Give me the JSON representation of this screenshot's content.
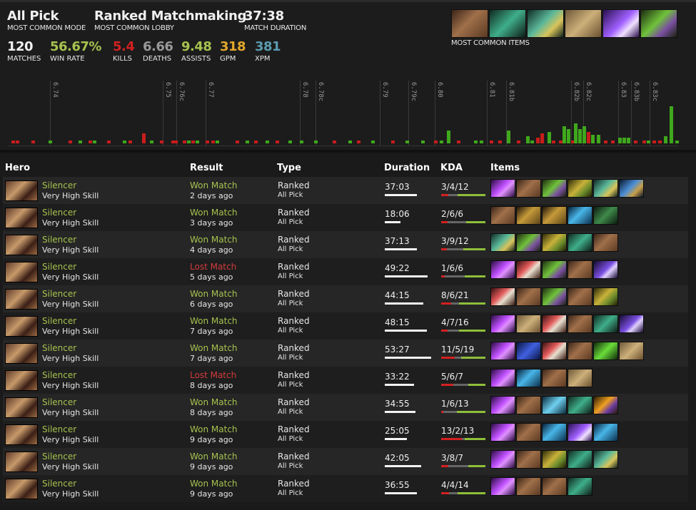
{
  "summary": {
    "mode": {
      "value": "All Pick",
      "caption": "MOST COMMON MODE"
    },
    "lobby": {
      "value": "Ranked Matchmaking",
      "caption": "MOST COMMON LOBBY"
    },
    "duration": {
      "value": "37:38",
      "caption": "MATCH DURATION"
    },
    "matches": {
      "value": "120",
      "caption": "MATCHES",
      "color": "#f0f0f0"
    },
    "winrate": {
      "value": "56.67%",
      "caption": "WIN RATE",
      "color": "#a6c24e"
    },
    "kills": {
      "value": "5.4",
      "caption": "KILLS",
      "color": "#d42020"
    },
    "deaths": {
      "value": "6.66",
      "caption": "DEATHS",
      "color": "#999999"
    },
    "assists": {
      "value": "9.48",
      "caption": "ASSISTS",
      "color": "#a6c24e"
    },
    "gpm": {
      "value": "318",
      "caption": "GPM",
      "color": "#e3a82b"
    },
    "xpm": {
      "value": "381",
      "caption": "XPM",
      "color": "#5b9bb0"
    },
    "items_caption": "MOST COMMON ITEMS",
    "common_items": [
      "boots-icon",
      "shadow-blade-icon",
      "magic-wand-icon",
      "scroll-icon",
      "silver-edge-icon",
      "bottle-icon"
    ]
  },
  "patches": [
    "6.74",
    "6.75",
    "6.76c",
    "6.77",
    "6.78",
    "6.78c",
    "6.79",
    "6.79c",
    "6.80",
    "6.81",
    "6.81b",
    "6.82b",
    "6.82c",
    "6.83",
    "6.83b",
    "6.83c"
  ],
  "colors": {
    "win": "#a6c24e",
    "loss": "#d43a3a",
    "bar_win": "#3fa81c",
    "bar_loss": "#c91c1c"
  },
  "headers": {
    "hero": "Hero",
    "result": "Result",
    "type": "Type",
    "duration": "Duration",
    "kda": "KDA",
    "items": "Items"
  },
  "matches": [
    {
      "hero": "Silencer",
      "skill": "Very High Skill",
      "result": "Won Match",
      "win": true,
      "ago": "2 days ago",
      "type": "Ranked",
      "mode": "All Pick",
      "duration": "37:03",
      "dur_min": 37.05,
      "kda": "3/4/12",
      "k": 3,
      "d": 4,
      "a": 12,
      "items": [
        "dagon-icon",
        "boots-icon",
        "bottle-icon",
        "tango-icon",
        "magic-wand-icon",
        "stick-icon"
      ]
    },
    {
      "hero": "Silencer",
      "skill": "Very High Skill",
      "result": "Won Match",
      "win": true,
      "ago": "3 days ago",
      "type": "Ranked",
      "mode": "All Pick",
      "duration": "18:06",
      "dur_min": 18.1,
      "kda": "2/6/6",
      "k": 2,
      "d": 6,
      "a": 6,
      "items": [
        "boots-icon",
        "gloves-icon",
        "gloves-icon",
        "ring-icon",
        "branch-icon"
      ]
    },
    {
      "hero": "Silencer",
      "skill": "Very High Skill",
      "result": "Won Match",
      "win": true,
      "ago": "4 days ago",
      "type": "Ranked",
      "mode": "All Pick",
      "duration": "37:13",
      "dur_min": 37.2,
      "kda": "3/9/12",
      "k": 3,
      "d": 9,
      "a": 12,
      "items": [
        "magic-wand-icon",
        "bottle-icon",
        "tango-icon",
        "shadow-blade-icon",
        "boots-icon"
      ]
    },
    {
      "hero": "Silencer",
      "skill": "Very High Skill",
      "result": "Lost Match",
      "win": false,
      "ago": "5 days ago",
      "type": "Ranked",
      "mode": "All Pick",
      "duration": "49:22",
      "dur_min": 49.4,
      "kda": "1/6/6",
      "k": 1,
      "d": 6,
      "a": 6,
      "items": [
        "dagon-icon",
        "salve-icon",
        "bottle-icon",
        "boots-icon",
        "orb-icon"
      ]
    },
    {
      "hero": "Silencer",
      "skill": "Very High Skill",
      "result": "Won Match",
      "win": true,
      "ago": "6 days ago",
      "type": "Ranked",
      "mode": "All Pick",
      "duration": "44:15",
      "dur_min": 44.25,
      "kda": "8/6/21",
      "k": 8,
      "d": 6,
      "a": 21,
      "items": [
        "salve-icon",
        "boots-icon",
        "bottle-icon",
        "boots-icon",
        "tango-icon"
      ]
    },
    {
      "hero": "Silencer",
      "skill": "Very High Skill",
      "result": "Won Match",
      "win": true,
      "ago": "7 days ago",
      "type": "Ranked",
      "mode": "All Pick",
      "duration": "48:15",
      "dur_min": 48.25,
      "kda": "4/7/16",
      "k": 4,
      "d": 7,
      "a": 16,
      "items": [
        "dagon-icon",
        "scroll-icon",
        "salve-icon",
        "boots-icon",
        "shadow-blade-icon",
        "orb-icon"
      ]
    },
    {
      "hero": "Silencer",
      "skill": "Very High Skill",
      "result": "Won Match",
      "win": true,
      "ago": "7 days ago",
      "type": "Ranked",
      "mode": "All Pick",
      "duration": "53:27",
      "dur_min": 53.45,
      "kda": "11/5/19",
      "k": 11,
      "d": 5,
      "a": 19,
      "items": [
        "dagon-icon",
        "claw-icon",
        "salve-icon",
        "boots-icon",
        "swirl-icon",
        "scroll-icon"
      ]
    },
    {
      "hero": "Silencer",
      "skill": "Very High Skill",
      "result": "Lost Match",
      "win": false,
      "ago": "8 days ago",
      "type": "Ranked",
      "mode": "All Pick",
      "duration": "33:22",
      "dur_min": 33.35,
      "kda": "5/6/7",
      "k": 5,
      "d": 6,
      "a": 7,
      "items": [
        "dagon-icon",
        "ring-icon",
        "boots-icon",
        "scroll-icon"
      ]
    },
    {
      "hero": "Silencer",
      "skill": "Very High Skill",
      "result": "Won Match",
      "win": true,
      "ago": "8 days ago",
      "type": "Ranked",
      "mode": "All Pick",
      "duration": "34:55",
      "dur_min": 34.9,
      "kda": "1/6/13",
      "k": 1,
      "d": 6,
      "a": 13,
      "items": [
        "dagon-icon",
        "boots-icon",
        "gem-icon",
        "shadow-blade-icon",
        "flask-icon"
      ]
    },
    {
      "hero": "Silencer",
      "skill": "Very High Skill",
      "result": "Won Match",
      "win": true,
      "ago": "9 days ago",
      "type": "Ranked",
      "mode": "All Pick",
      "duration": "25:05",
      "dur_min": 25.1,
      "kda": "13/2/13",
      "k": 13,
      "d": 2,
      "a": 13,
      "items": [
        "dagon-icon",
        "boots-icon",
        "ring-icon",
        "silver-edge-icon",
        "ring-icon"
      ]
    },
    {
      "hero": "Silencer",
      "skill": "Very High Skill",
      "result": "Won Match",
      "win": true,
      "ago": "9 days ago",
      "type": "Ranked",
      "mode": "All Pick",
      "duration": "42:05",
      "dur_min": 42.1,
      "kda": "3/8/7",
      "k": 3,
      "d": 8,
      "a": 7,
      "items": [
        "dagon-icon",
        "boots-icon",
        "tango-icon",
        "shadow-blade-icon",
        "magic-wand-icon"
      ]
    },
    {
      "hero": "Silencer",
      "skill": "Very High Skill",
      "result": "Won Match",
      "win": true,
      "ago": "9 days ago",
      "type": "Ranked",
      "mode": "All Pick",
      "duration": "36:55",
      "dur_min": 36.9,
      "kda": "4/4/14",
      "k": 4,
      "d": 4,
      "a": 14,
      "items": [
        "dagon-icon",
        "boots-icon",
        "boots-icon",
        "shadow-blade-icon"
      ]
    }
  ]
}
